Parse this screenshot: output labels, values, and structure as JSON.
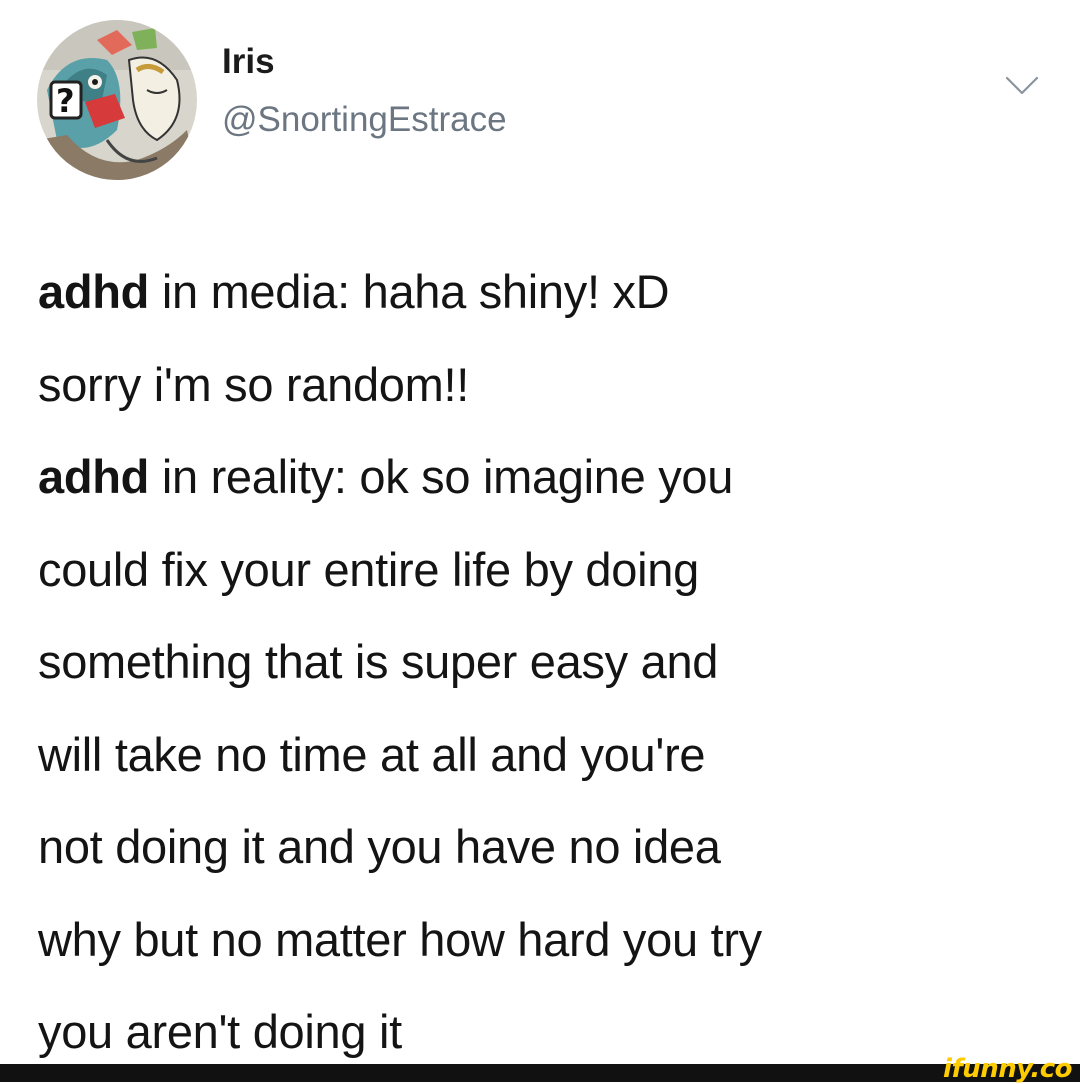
{
  "tweet": {
    "author": {
      "display_name": "Iris",
      "handle": "@SnortingEstrace"
    },
    "menu_icon": "chevron-down-icon",
    "lines": [
      {
        "bold": "adhd",
        "text": " in media: haha shiny! xD"
      },
      {
        "bold": "",
        "text": "sorry i'm so random!!"
      },
      {
        "bold": "adhd",
        "text": " in reality: ok so imagine you"
      },
      {
        "bold": "",
        "text": "could fix your entire life by doing"
      },
      {
        "bold": "",
        "text": "something that is super easy and"
      },
      {
        "bold": "",
        "text": "will take no time at all and you're"
      },
      {
        "bold": "",
        "text": "not doing it and you have no idea"
      },
      {
        "bold": "",
        "text": "why but no matter how hard you try"
      },
      {
        "bold": "",
        "text": "you aren't doing it"
      }
    ]
  },
  "watermark": {
    "text": "ifunny.co",
    "color": "#ffcc00"
  },
  "colors": {
    "handle": "#6b7682",
    "text": "#141414",
    "footer": "#111111"
  }
}
